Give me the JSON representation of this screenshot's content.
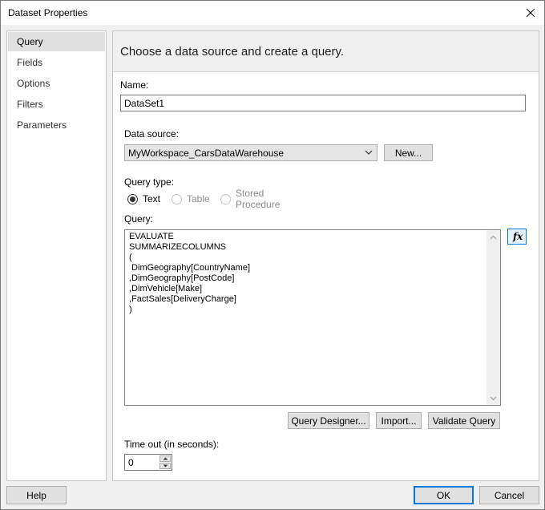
{
  "window": {
    "title": "Dataset Properties"
  },
  "nav": {
    "items": [
      {
        "label": "Query",
        "selected": true
      },
      {
        "label": "Fields",
        "selected": false
      },
      {
        "label": "Options",
        "selected": false
      },
      {
        "label": "Filters",
        "selected": false
      },
      {
        "label": "Parameters",
        "selected": false
      }
    ]
  },
  "panel": {
    "heading": "Choose a data source and create a query.",
    "name_label": "Name:",
    "name_value": "DataSet1",
    "datasource_label": "Data source:",
    "datasource_value": "MyWorkspace_CarsDataWarehouse",
    "new_button": "New...",
    "querytype_label": "Query type:",
    "querytype_options": [
      {
        "label": "Text",
        "checked": true,
        "enabled": true
      },
      {
        "label": "Table",
        "checked": false,
        "enabled": false
      },
      {
        "label": "Stored Procedure",
        "checked": false,
        "enabled": false
      }
    ],
    "query_label": "Query:",
    "query_text": "EVALUATE\nSUMMARIZECOLUMNS\n(\n DimGeography[CountryName]\n,DimGeography[PostCode]\n,DimVehicle[Make]\n,FactSales[DeliveryCharge]\n)",
    "fx_button": "fx",
    "query_designer_button": "Query Designer...",
    "import_button": "Import...",
    "validate_button": "Validate Query",
    "timeout_label": "Time out (in seconds):",
    "timeout_value": "0"
  },
  "footer": {
    "help_button": "Help",
    "ok_button": "OK",
    "cancel_button": "Cancel"
  },
  "icons": {
    "close": "close-icon",
    "dropdown": "chevron-down-icon",
    "scroll_up": "scroll-up-arrow-icon",
    "scroll_down": "scroll-down-arrow-icon",
    "spin_up": "spin-up-arrow-icon",
    "spin_down": "spin-down-arrow-icon"
  },
  "colors": {
    "accent": "#0078d7",
    "window_bg": "#f0f0f0",
    "selected_nav": "#e0e0e0"
  }
}
